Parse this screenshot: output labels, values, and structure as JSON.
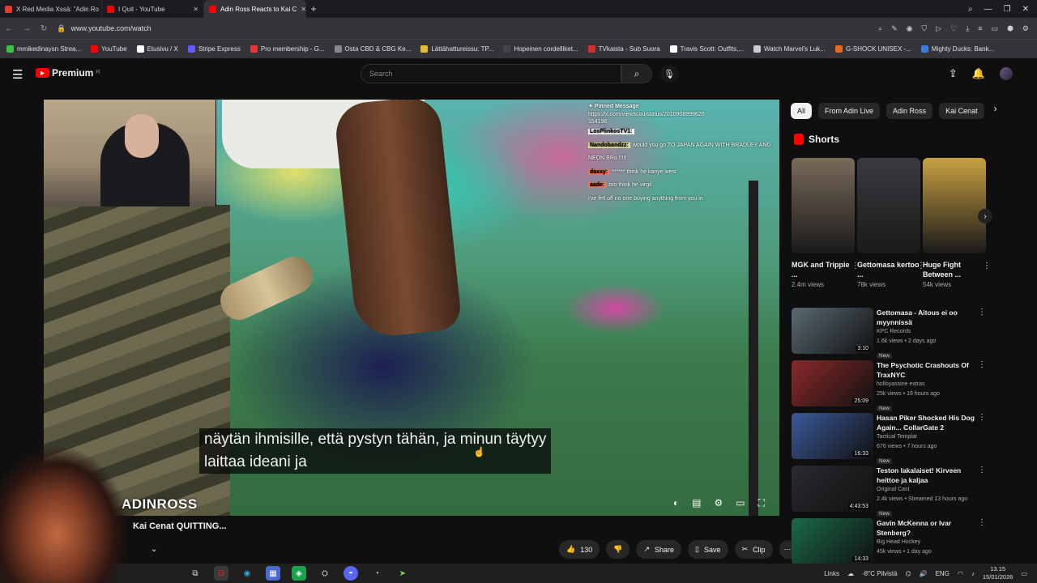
{
  "browser": {
    "tabs": [
      {
        "label": "X Red Media Xssä: \"Adin Ro",
        "color": "#e23b2e"
      },
      {
        "label": "I Quit - YouTube",
        "color": "#ff0000"
      },
      {
        "label": "Adin Ross Reacts to Kai C",
        "color": "#ff0000"
      }
    ],
    "new_tab": "+",
    "url": "www.youtube.com/watch",
    "bookmarks": [
      {
        "label": "mmikedinaysn Strea...",
        "color": "#36c43a"
      },
      {
        "label": "YouTube",
        "color": "#ff0000"
      },
      {
        "label": "Etusivu / X",
        "color": "#ffffff"
      },
      {
        "label": "Stripe Express",
        "color": "#635bff"
      },
      {
        "label": "Pro membership - G...",
        "color": "#e53935"
      },
      {
        "label": "Osta CBD & CBG Ke...",
        "color": "#888888"
      },
      {
        "label": "Lättähattureissu: TP...",
        "color": "#e0c030"
      },
      {
        "label": "Hopeinen cordelliket...",
        "color": "#444444"
      },
      {
        "label": "TVkaista - Sub Suora",
        "color": "#d32f2f"
      },
      {
        "label": "Travis Scott: Outfits,...",
        "color": "#ffffff"
      },
      {
        "label": "Watch Marvel's Luk...",
        "color": "#cccccc"
      },
      {
        "label": "G-SHOCK UNISEX -...",
        "color": "#e86a1a"
      },
      {
        "label": "Mighty Ducks: Bank...",
        "color": "#3a7bd5"
      }
    ]
  },
  "youtube": {
    "brand": "Premium",
    "region": "FI",
    "search_placeholder": "Search",
    "video": {
      "title": "Kai Cenat QUITTING...",
      "watermark": "ADINROSS",
      "subtitle": "näytän ihmisille, että pystyn tähän, ja minun täytyy\nlaittaa ideani ja"
    },
    "chat": {
      "pinned_label": "Pinned Message",
      "pinned_text": "https://x.com/viewscou/status/2010908999626\n154196",
      "messages": [
        {
          "user": "LosPlinkosTV1:",
          "text": "",
          "color": "#ffffff"
        },
        {
          "user": "Nandobandzz:",
          "text": "would you go TO JAPAN AGAIN WITH BRADLEY AND NEON BRo !!!!!",
          "color": "#e0e0a0"
        },
        {
          "user": "",
          "text": "",
          "color": "#6ab0ff"
        },
        {
          "user": "daxxy:",
          "text": "****** think he kanye west",
          "color": "#ff7a5a"
        },
        {
          "user": "aade:",
          "text": "bro think he virgil",
          "color": "#ff7a5a"
        },
        {
          "user": "",
          "text": "i've fell off no one buying anything from you in",
          "color": "#ffffff"
        }
      ]
    },
    "actions": {
      "likes": "130",
      "share": "Share",
      "save": "Save",
      "clip": "Clip"
    },
    "chips": [
      "All",
      "From Adin Live",
      "Adin Ross",
      "Kai Cenat"
    ],
    "shorts_heading": "Shorts",
    "shorts": [
      {
        "title": "MGK and Trippie ...",
        "views": "2.4m views",
        "color": "#7a6a5a"
      },
      {
        "title": "Gettomasa kertoo ...",
        "views": "78k views",
        "color": "#3a3a40"
      },
      {
        "title": "Huge Fight Between ...",
        "views": "54k views",
        "color": "#c8a040"
      }
    ],
    "recommendations": [
      {
        "title": "Gettomasa - Aitous ei oo myynnissä",
        "channel": "KPC Records",
        "meta": "1.6k views • 2 days ago",
        "badge": "New",
        "duration": "3:10",
        "color": "#5a6a72"
      },
      {
        "title": "The Psychotic Crashouts Of TraxNYC",
        "channel": "holloyassine extras",
        "meta": "25k views • 19 hours ago",
        "badge": "New",
        "duration": "25:09",
        "color": "#8a2a2a"
      },
      {
        "title": "Hasan Piker Shocked His Dog Again... CollarGate 2",
        "channel": "Tactical Templar",
        "meta": "676 views • 7 hours ago",
        "badge": "New",
        "duration": "16:33",
        "color": "#3a5a9a"
      },
      {
        "title": "Teston lakalaiset! Kirveen heittoe ja kaljaa",
        "channel": "Original Cast",
        "meta": "2.4k views • Streamed 13 hours ago",
        "badge": "New",
        "duration": "4:43:53",
        "color": "#2a2a30"
      },
      {
        "title": "Gavin McKenna or Ivar Stenberg?",
        "channel": "Big Head Hockey",
        "meta": "45k views • 1 day ago",
        "badge": "",
        "duration": "14:33",
        "color": "#1a6a4a"
      }
    ]
  },
  "taskbar": {
    "links": "Links",
    "weather": "-8°C Pilvistä",
    "lang": "ENG",
    "time": "13.15",
    "date": "15/01/2026"
  }
}
